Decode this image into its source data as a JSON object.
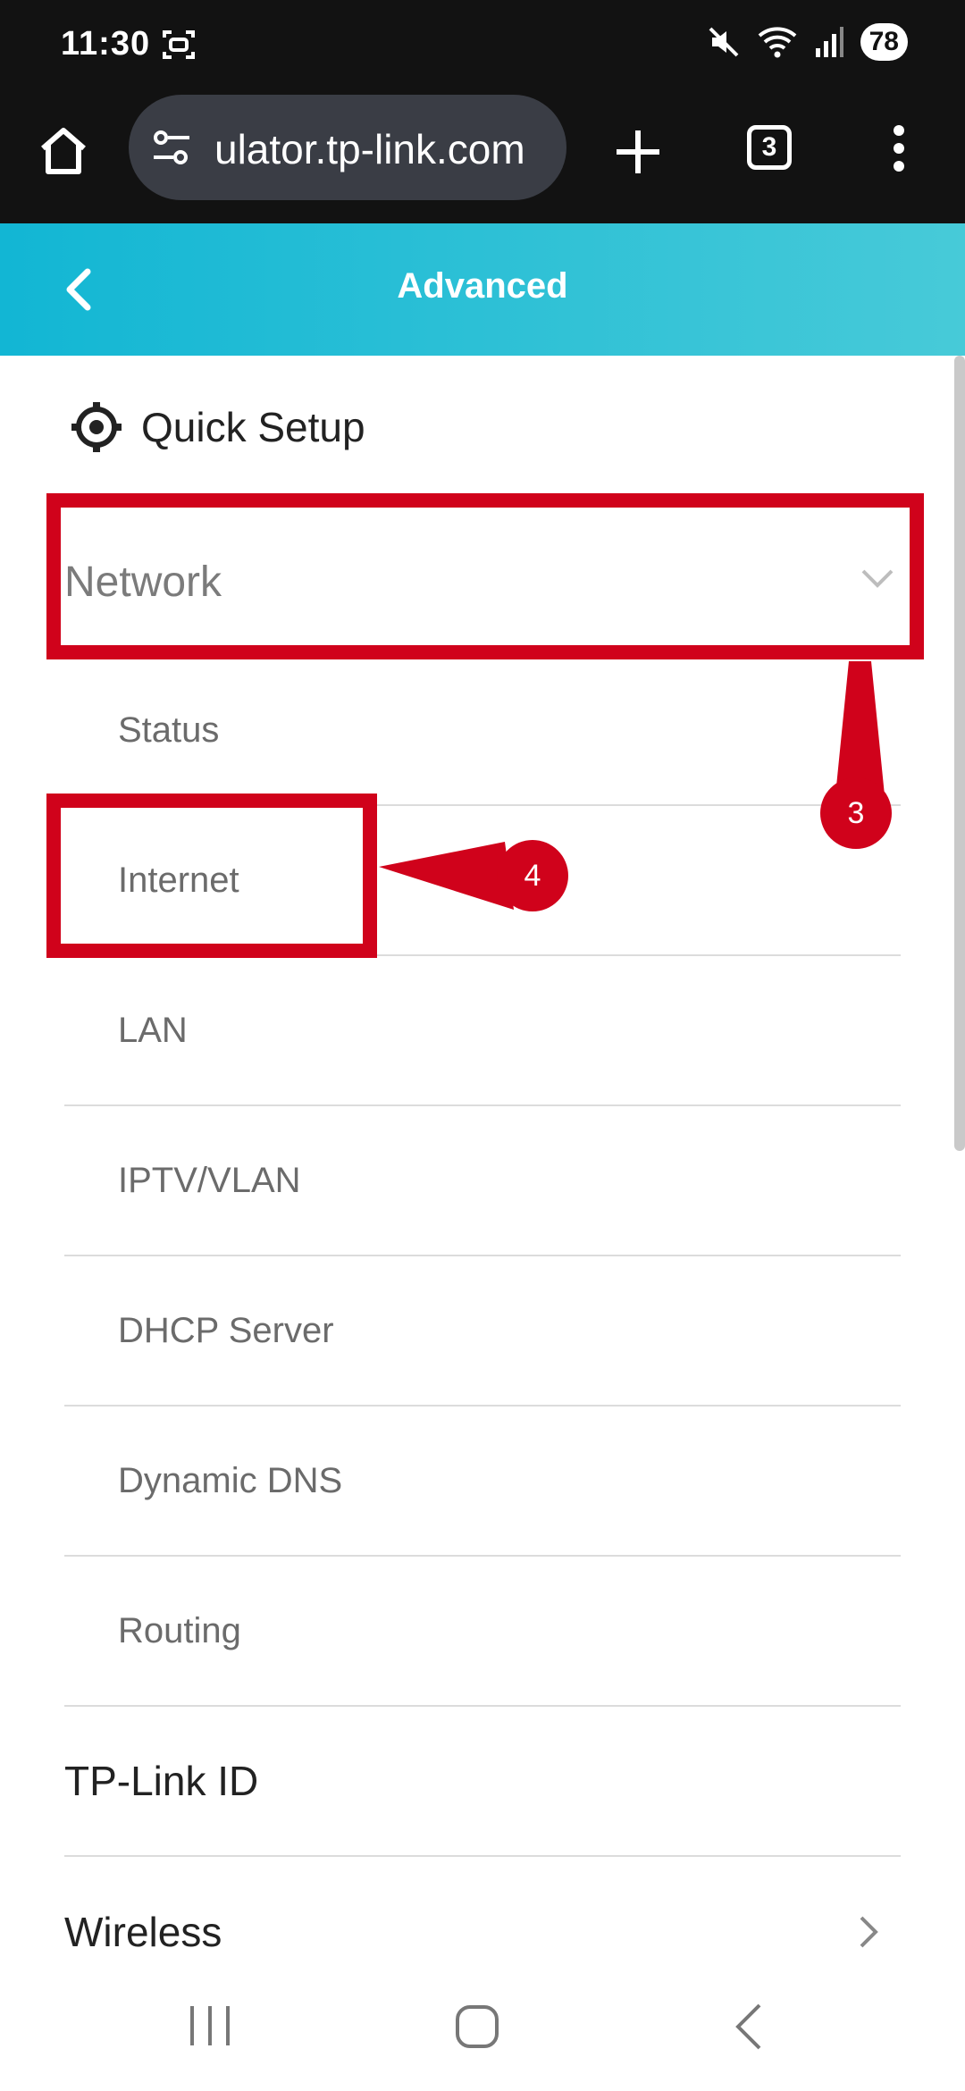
{
  "status_bar": {
    "time": "11:30",
    "battery": "78"
  },
  "browser": {
    "url": "ulator.tp-link.com",
    "tab_count": "3"
  },
  "header": {
    "title": "Advanced"
  },
  "menu": {
    "quick_setup": "Quick Setup",
    "network": "Network",
    "network_items": [
      "Status",
      "Internet",
      "LAN",
      "IPTV/VLAN",
      "DHCP Server",
      "Dynamic DNS",
      "Routing"
    ],
    "tp_link_id": "TP-Link ID",
    "wireless": "Wireless"
  },
  "annotations": {
    "step_network": "3",
    "step_internet": "4",
    "color": "#d0021b"
  },
  "theme": {
    "header_gradient_start": "#12b6d4",
    "header_gradient_end": "#47cad8"
  }
}
